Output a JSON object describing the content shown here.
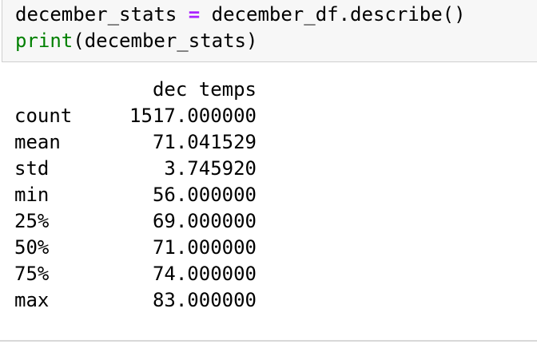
{
  "code": {
    "line1": {
      "var": "december_stats",
      "op": "=",
      "expr": "december_df.describe()"
    },
    "line2": {
      "func": "print",
      "args": "(december_stats)"
    }
  },
  "output": {
    "column_header": "dec temps",
    "rows": [
      {
        "label": "count",
        "value": "1517.000000"
      },
      {
        "label": "mean",
        "value": "71.041529"
      },
      {
        "label": "std",
        "value": "3.745920"
      },
      {
        "label": "min",
        "value": "56.000000"
      },
      {
        "label": "25%",
        "value": "69.000000"
      },
      {
        "label": "50%",
        "value": "71.000000"
      },
      {
        "label": "75%",
        "value": "74.000000"
      },
      {
        "label": "max",
        "value": "83.000000"
      }
    ]
  },
  "colors": {
    "operator": "#aa22ff",
    "builtin": "#008000",
    "input_bg": "#f7f7f7"
  }
}
